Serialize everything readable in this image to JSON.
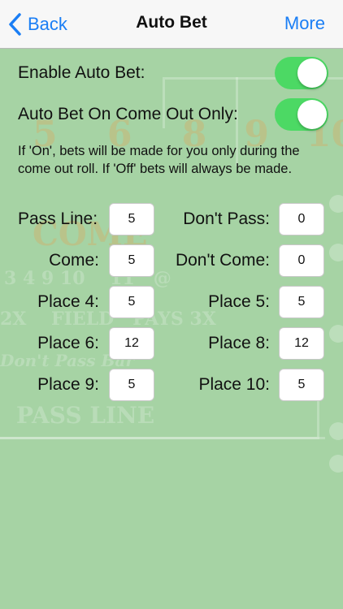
{
  "nav": {
    "back_label": "Back",
    "title": "Auto Bet",
    "more_label": "More"
  },
  "settings": {
    "enable_label": "Enable Auto Bet:",
    "enable_on": true,
    "come_out_label": "Auto Bet On Come Out Only:",
    "come_out_on": true,
    "note": "If 'On', bets will be made for you only during the come out roll. If 'Off' bets will always be made."
  },
  "bets": {
    "pass_line": {
      "label": "Pass Line:",
      "value": "5"
    },
    "dont_pass": {
      "label": "Don't Pass:",
      "value": "0"
    },
    "come": {
      "label": "Come:",
      "value": "5"
    },
    "dont_come": {
      "label": "Don't Come:",
      "value": "0"
    },
    "place_4": {
      "label": "Place 4:",
      "value": "5"
    },
    "place_5": {
      "label": "Place 5:",
      "value": "5"
    },
    "place_6": {
      "label": "Place 6:",
      "value": "12"
    },
    "place_8": {
      "label": "Place 8:",
      "value": "12"
    },
    "place_9": {
      "label": "Place 9:",
      "value": "5"
    },
    "place_10": {
      "label": "Place 10:",
      "value": "5"
    }
  },
  "colors": {
    "accent": "#1a7ef5",
    "toggle_on": "#4cd964",
    "felt": "#a6d3a4"
  }
}
